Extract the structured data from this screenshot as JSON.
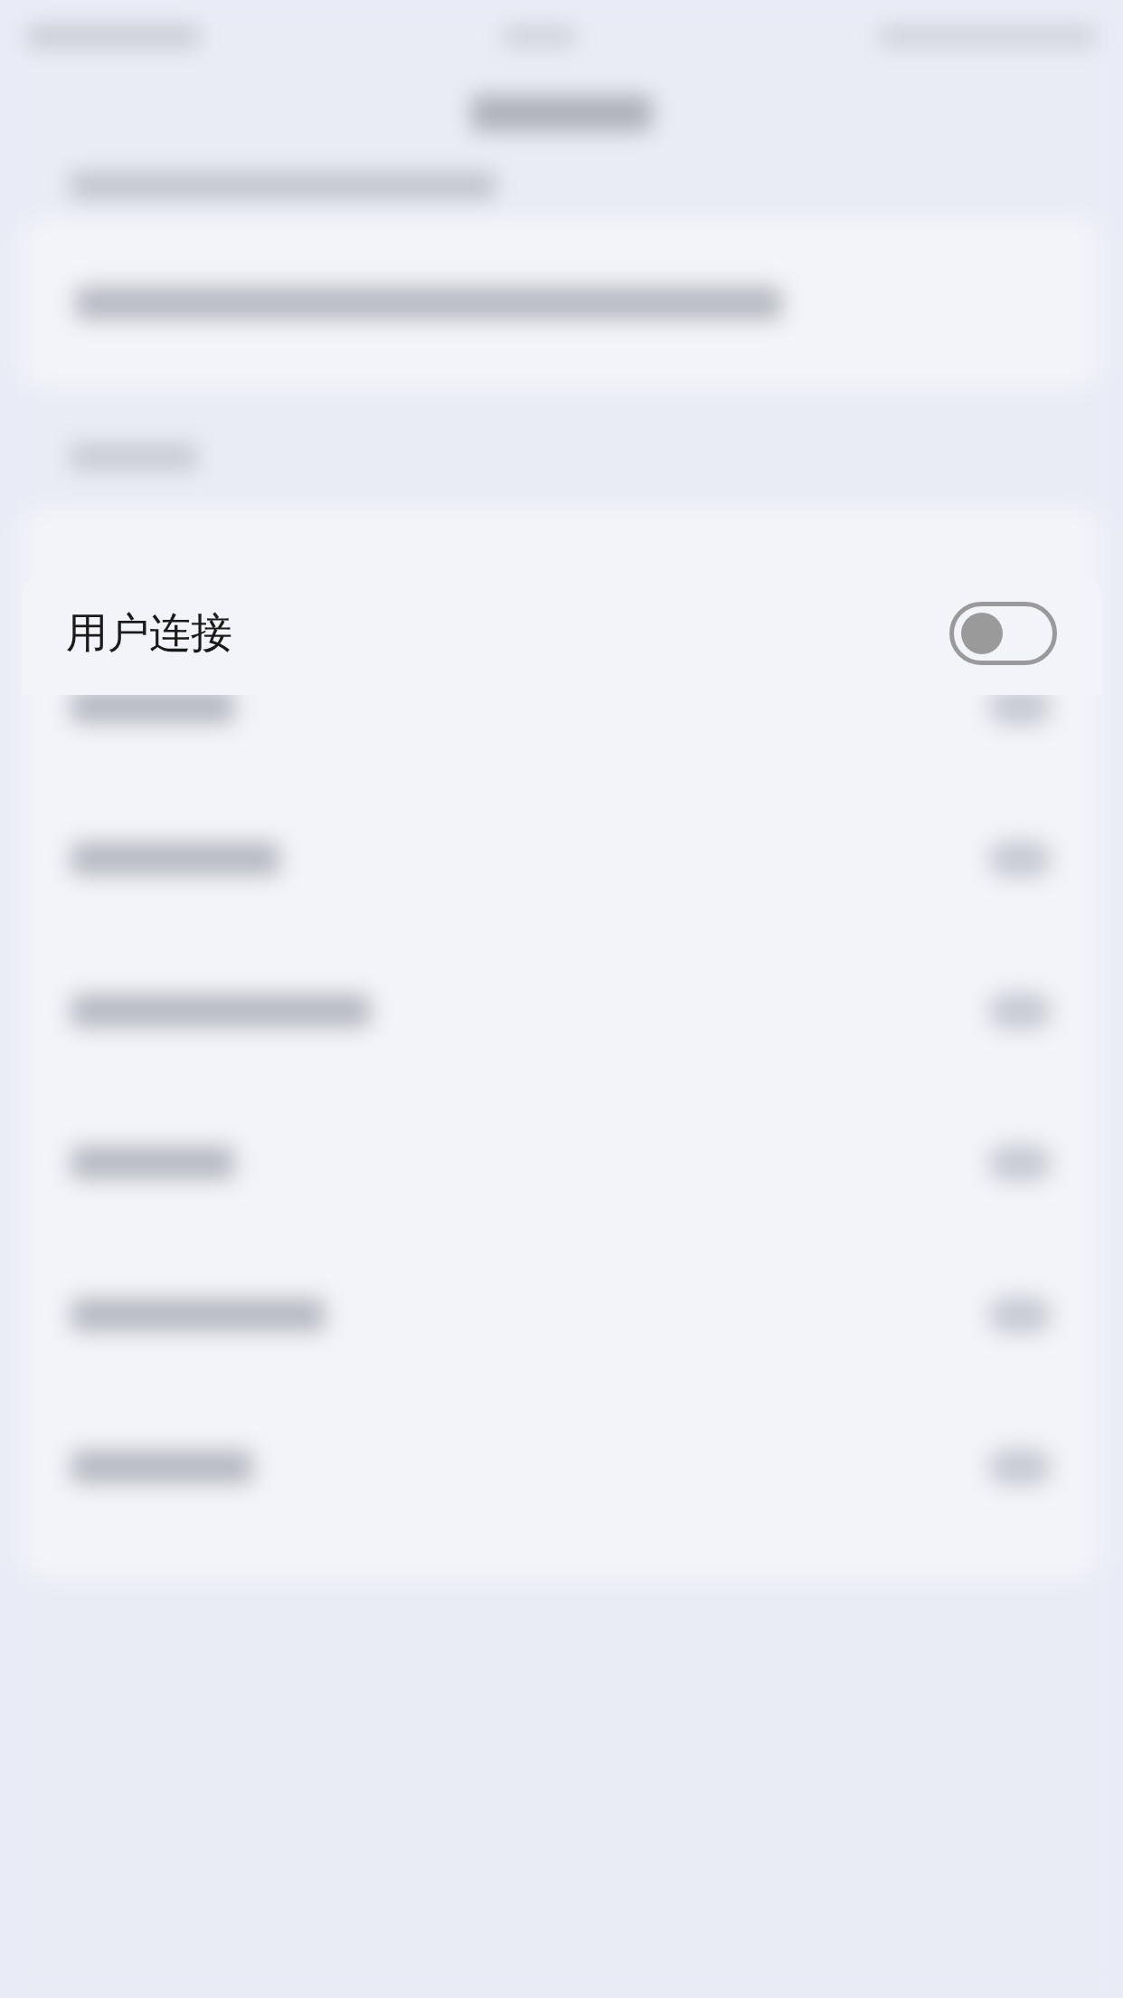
{
  "setting": {
    "label": "用户连接",
    "on": false
  }
}
